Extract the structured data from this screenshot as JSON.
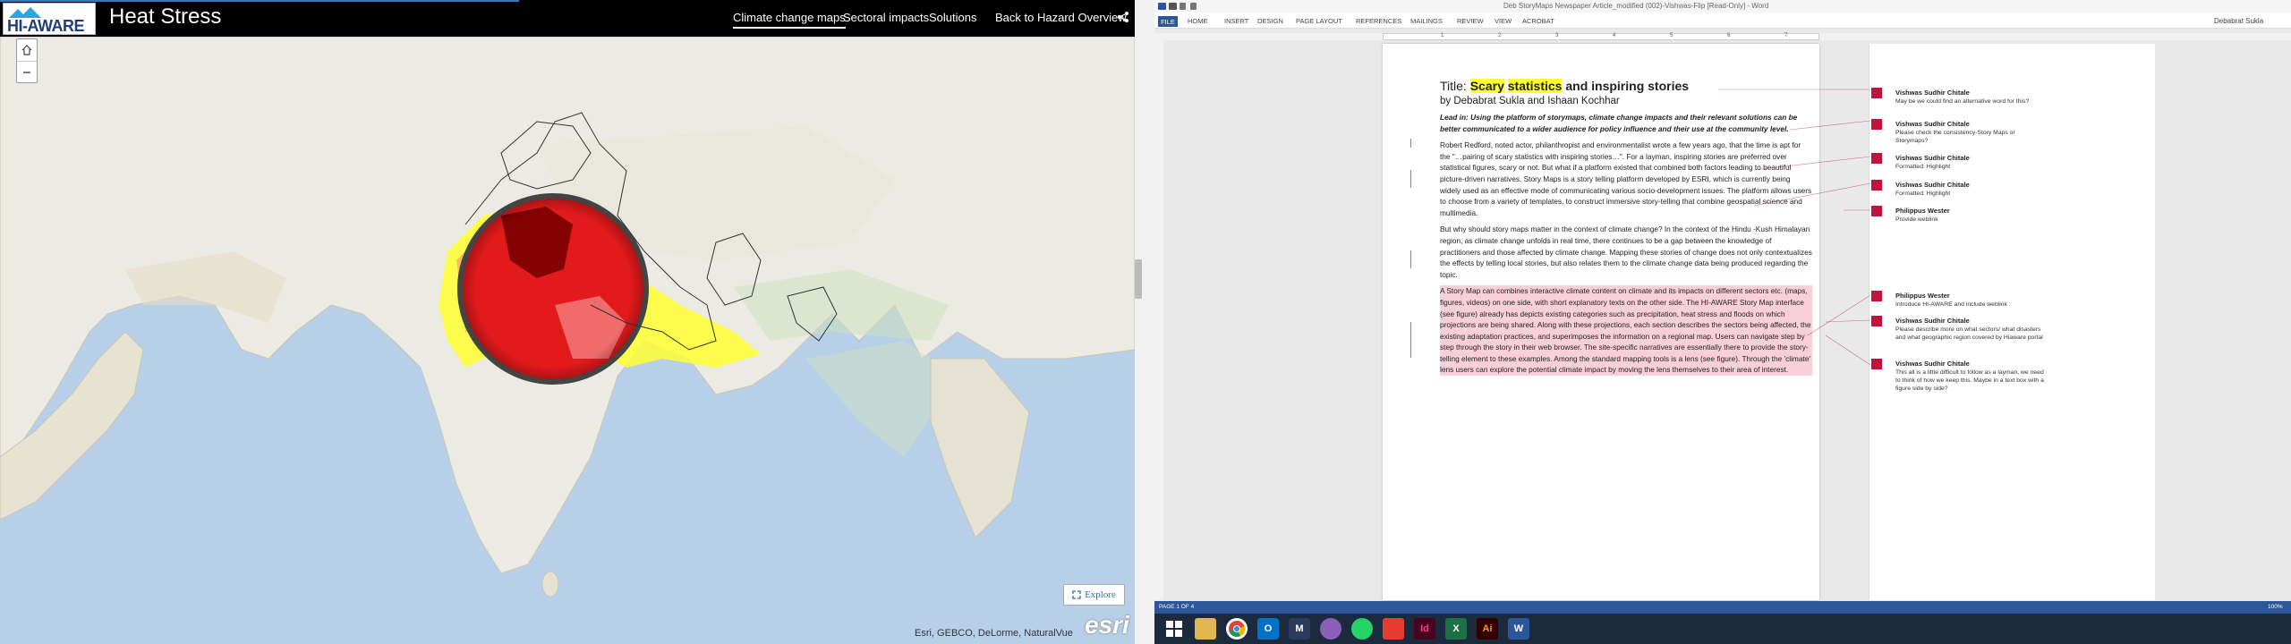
{
  "storymap": {
    "logo_text": "HI-AWARE",
    "title": "Heat Stress",
    "tabs": [
      "Climate change maps",
      "Sectoral impacts",
      "Solutions"
    ],
    "back_link": "Back to Hazard Overview",
    "explore_label": "Explore",
    "attribution": "Esri, GEBCO, DeLorme, NaturalVue",
    "esri_logo": "esri"
  },
  "word": {
    "window_title": "Deb StoryMaps Newspaper Article_modified (002)-Vishwas-Flip [Read-Only] - Word",
    "user": "Debabrat Sukla",
    "file_label": "FILE",
    "menu": [
      "HOME",
      "INSERT",
      "DESIGN",
      "PAGE LAYOUT",
      "REFERENCES",
      "MAILINGS",
      "REVIEW",
      "VIEW",
      "ACROBAT"
    ],
    "ruler_numbers": [
      "1",
      "2",
      "3",
      "4",
      "5",
      "6",
      "7"
    ],
    "status_page": "PAGE 1 OF 4",
    "status_zoom": "100%",
    "document": {
      "title_prefix": "Title: ",
      "title_word1": "Scary",
      "title_word2": "statistics",
      "title_rest": " and inspiring stories",
      "byline": "by Debabrat Sukla and Ishaan Kochhar",
      "lead": "Lead in: Using the platform of storymaps, climate change impacts and their relevant solutions can be better communicated to a wider audience for policy influence and their use at the community level.",
      "para1": "Robert Redford, noted actor, philanthropist and environmentalist wrote a few years ago, that the time is apt for the \"…pairing of scary statistics with inspiring stories…\". For a layman, inspiring stories are preferred over statistical figures, scary or not. But what if a platform existed that combined both factors leading to beautiful picture-driven narratives. Story Maps is a story telling platform developed by ESRI, which is currently being widely used as an effective mode of communicating various socio-development issues. The platform allows users to choose from a variety of templates, to construct immersive story-telling that combine geospatial science and multimedia.",
      "para2": "But why should story maps matter in the context of climate change? In the context of the Hindu -Kush Himalayan region, as climate change unfolds in real time, there continues to be a gap between the knowledge of practitioners and those affected by climate change. Mapping these stories of change does not only contextualizes the effects by telling local stories, but also relates them to the climate change data being produced regarding the topic.",
      "para3": "A Story Map can combines interactive climate content on climate and its impacts on different sectors etc. (maps, figures, videos) on one side, with short explanatory texts on the other side. The HI-AWARE Story Map interface (see figure) already has depicts existing categories such as precipitation, heat stress and floods on which projections are being shared. Along with these projections, each section describes the sectors being affected, the existing adaptation practices, and superimposes the information on a regional map. Users can navigate step by step through the story in their web browser. The site-specific narratives are essentially there to provide the story-telling element to these examples. Among the standard mapping tools is a lens (see figure). Through the 'climate' lens users can explore the potential climate impact by moving the lens themselves to their area of interest."
    },
    "comments": [
      {
        "author": "Vishwas Sudhir Chitale",
        "text": "May be we could find an alternative word for this?"
      },
      {
        "author": "Vishwas Sudhir Chitale",
        "text": "Please check the consistency-Story Maps or Storymaps?"
      },
      {
        "author": "Vishwas Sudhir Chitale",
        "text": "Formatted: Highlight"
      },
      {
        "author": "Vishwas Sudhir Chitale",
        "text": "Formatted: Highlight"
      },
      {
        "author": "Philippus Wester",
        "text": "Provide weblink"
      },
      {
        "author": "Philippus Wester",
        "text": "Introduce HI-AWARE and include weblink"
      },
      {
        "author": "Vishwas Sudhir Chitale",
        "text": "Please describe more on what sectors/ what disasters and what geographic region covered by Hiaware portal"
      },
      {
        "author": "Vishwas Sudhir Chitale",
        "text": "This all is a little difficult to follow as a layman, we need to think of how we keep this. Maybe in a text box with a figure side by side?"
      }
    ]
  },
  "taskbar": {
    "apps": [
      "start-icon",
      "explorer-icon",
      "chrome-icon",
      "outlook-icon",
      "arcgis-icon",
      "picasa-icon",
      "whatsapp-icon",
      "anydesk-icon",
      "indesign-icon",
      "excel-icon",
      "illustrator-icon",
      "word-icon"
    ],
    "colors": {
      "accent": "#2b579a",
      "heat_dark": "#7a0000",
      "heat_red": "#e31a1c",
      "heat_yellow": "#ffff33"
    }
  }
}
